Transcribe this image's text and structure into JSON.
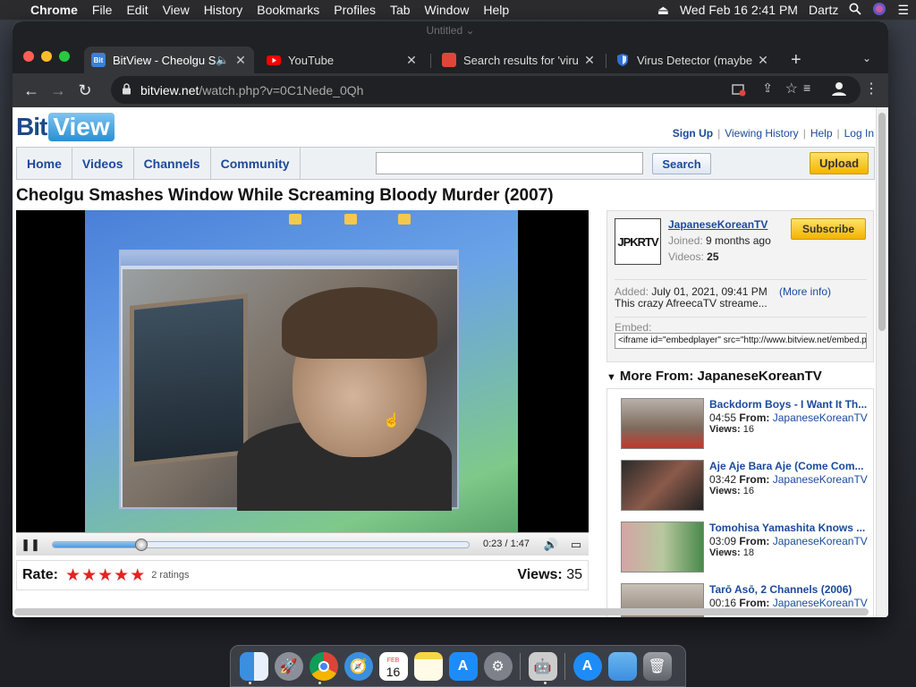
{
  "menubar": {
    "app": "Chrome",
    "items": [
      "File",
      "Edit",
      "View",
      "History",
      "Bookmarks",
      "Profiles",
      "Tab",
      "Window",
      "Help"
    ],
    "datetime": "Wed Feb 16  2:41 PM",
    "user": "Dartz"
  },
  "window": {
    "title": "Untitled ⌄"
  },
  "tabs": [
    {
      "label": "BitView - Cheolgu S",
      "icon": "bitview-favicon",
      "color": "#3b7fd8"
    },
    {
      "label": "YouTube",
      "icon": "youtube-favicon",
      "color": "#ff0000"
    },
    {
      "label": "Search results for 'viru",
      "icon": "search-results-favicon",
      "color": "#e0453a"
    },
    {
      "label": "Virus Detector (maybe",
      "icon": "shield-favicon",
      "color": "#2f6fd6"
    }
  ],
  "address": {
    "host": "bitview.net",
    "path": "/watch.php?v=0C1Nede_0Qh"
  },
  "site": {
    "logo_bit": "Bit",
    "logo_view": "View",
    "toplinks": {
      "signup": "Sign Up",
      "history": "Viewing History",
      "help": "Help",
      "login": "Log In"
    },
    "nav": [
      "Home",
      "Videos",
      "Channels",
      "Community"
    ],
    "search_button": "Search",
    "search_value": "",
    "upload_button": "Upload"
  },
  "video": {
    "title": "Cheolgu Smashes Window While Screaming Bloody Murder (2007)",
    "current_time": "0:23",
    "duration": "1:47",
    "progress": 0.215,
    "timecode": "0:23 / 1:47"
  },
  "rating": {
    "label": "Rate:",
    "stars": 5,
    "count_text": "2 ratings",
    "views_label": "Views:",
    "views": "35"
  },
  "channel": {
    "thumb_text": "JPKRTV",
    "name": "JapaneseKoreanTV",
    "joined_label": "Joined:",
    "joined": "9 months ago",
    "videos_label": "Videos:",
    "videos": "25",
    "subscribe": "Subscribe",
    "added_label": "Added:",
    "added": "July 01, 2021, 09:41 PM",
    "more_info": "(More info)",
    "description": "This crazy AfreecaTV streame...",
    "embed_label": "Embed:",
    "embed_code": "<iframe id=\"embedplayer\" src=\"http://www.bitview.net/embed.php"
  },
  "more_from": {
    "heading": "More From: JapaneseKoreanTV",
    "from_label": "From:",
    "views_label": "Views:",
    "items": [
      {
        "title": "Backdorm Boys - I Want It Th...",
        "duration": "04:55",
        "channel": "JapaneseKoreanTV",
        "views": "16"
      },
      {
        "title": "Aje Aje Bara Aje (Come Com...",
        "duration": "03:42",
        "channel": "JapaneseKoreanTV",
        "views": "16"
      },
      {
        "title": "Tomohisa Yamashita Knows ...",
        "duration": "03:09",
        "channel": "JapaneseKoreanTV",
        "views": "18"
      },
      {
        "title": "Tarō Asō, 2 Channels (2006)",
        "duration": "00:16",
        "channel": "JapaneseKoreanTV",
        "views": ""
      }
    ]
  },
  "dock": {
    "apps": [
      "finder-icon",
      "launchpad-icon",
      "chrome-icon",
      "safari-icon",
      "calendar-icon",
      "notes-icon",
      "app-store-icon",
      "system-preferences-icon",
      "automator-icon",
      "app-store-2-icon",
      "downloads-folder-icon",
      "trash-icon"
    ],
    "calendar_day": "16"
  },
  "colors": {
    "accent": "#1a4a9c",
    "upload": "#f4b400",
    "star": "#e02424"
  }
}
